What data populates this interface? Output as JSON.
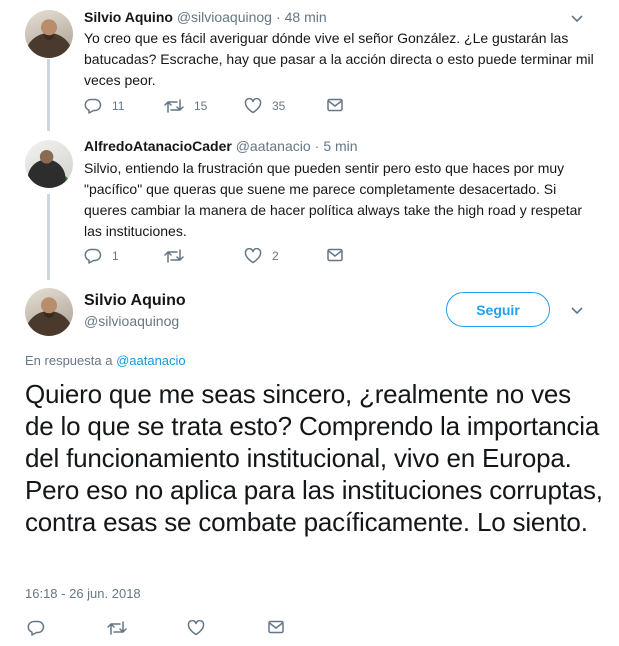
{
  "tweets": [
    {
      "name": "Silvio Aquino",
      "handle": "@silvioaquinog",
      "time": "48 min",
      "text": "Yo creo que es fácil averiguar dónde vive el señor González. ¿Le gustarán las batucadas? Escrache, hay que pasar a la acción directa o esto puede terminar mil veces peor.",
      "replies": "11",
      "retweets": "15",
      "likes": "35"
    },
    {
      "name": "AlfredoAtanacioCader",
      "handle": "@aatanacio",
      "time": "5 min",
      "text": "Silvio, entiendo la frustración que pueden sentir pero esto que haces por muy \"pacífico\" que queras que suene me parece completamente desacertado. Si queres cambiar la manera de hacer política always take the high road y respetar las instituciones.",
      "replies": "1",
      "retweets": "",
      "likes": "2"
    }
  ],
  "focus_tweet": {
    "name": "Silvio Aquino",
    "handle": "@silvioaquinog",
    "follow_label": "Seguir",
    "reply_prefix": "En respuesta a",
    "reply_to": "@aatanacio",
    "text": "Quiero que me seas sincero, ¿realmente no ves de lo que se trata esto? Comprendo la importancia del funcionamiento institucional, vivo en Europa. Pero eso no aplica para las instituciones corruptas, contra esas se combate pacíficamente. Lo siento.",
    "timestamp": "16:18 - 26 jun. 2018"
  },
  "colors": {
    "accent": "#1da1f2",
    "link": "#1b95e0",
    "muted": "#657786",
    "thread_line": "#ccd6dd"
  },
  "icons": [
    "reply-icon",
    "retweet-icon",
    "like-icon",
    "direct-message-icon",
    "chevron-down-icon"
  ]
}
